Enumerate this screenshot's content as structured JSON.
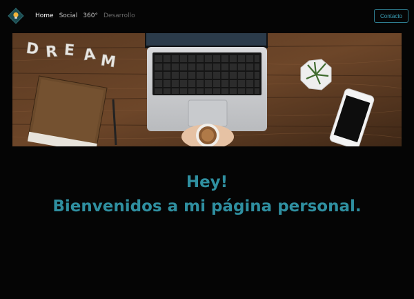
{
  "nav": {
    "logo_icon": "lightbulb-icon",
    "links": [
      {
        "label": "Home",
        "state": "active"
      },
      {
        "label": "Social",
        "state": "normal"
      },
      {
        "label": "360°",
        "state": "normal"
      },
      {
        "label": "Desarrollo",
        "state": "disabled"
      }
    ],
    "contact_label": "Contacto"
  },
  "hero": {
    "image": "desk-with-laptop-photo",
    "dream_text": "DREAM"
  },
  "main": {
    "greeting": "Hey!",
    "welcome": "Bienvenidos a mi página personal."
  },
  "colors": {
    "background": "#050505",
    "accent": "#2f8fa0",
    "contact_border": "#2f7f92"
  }
}
